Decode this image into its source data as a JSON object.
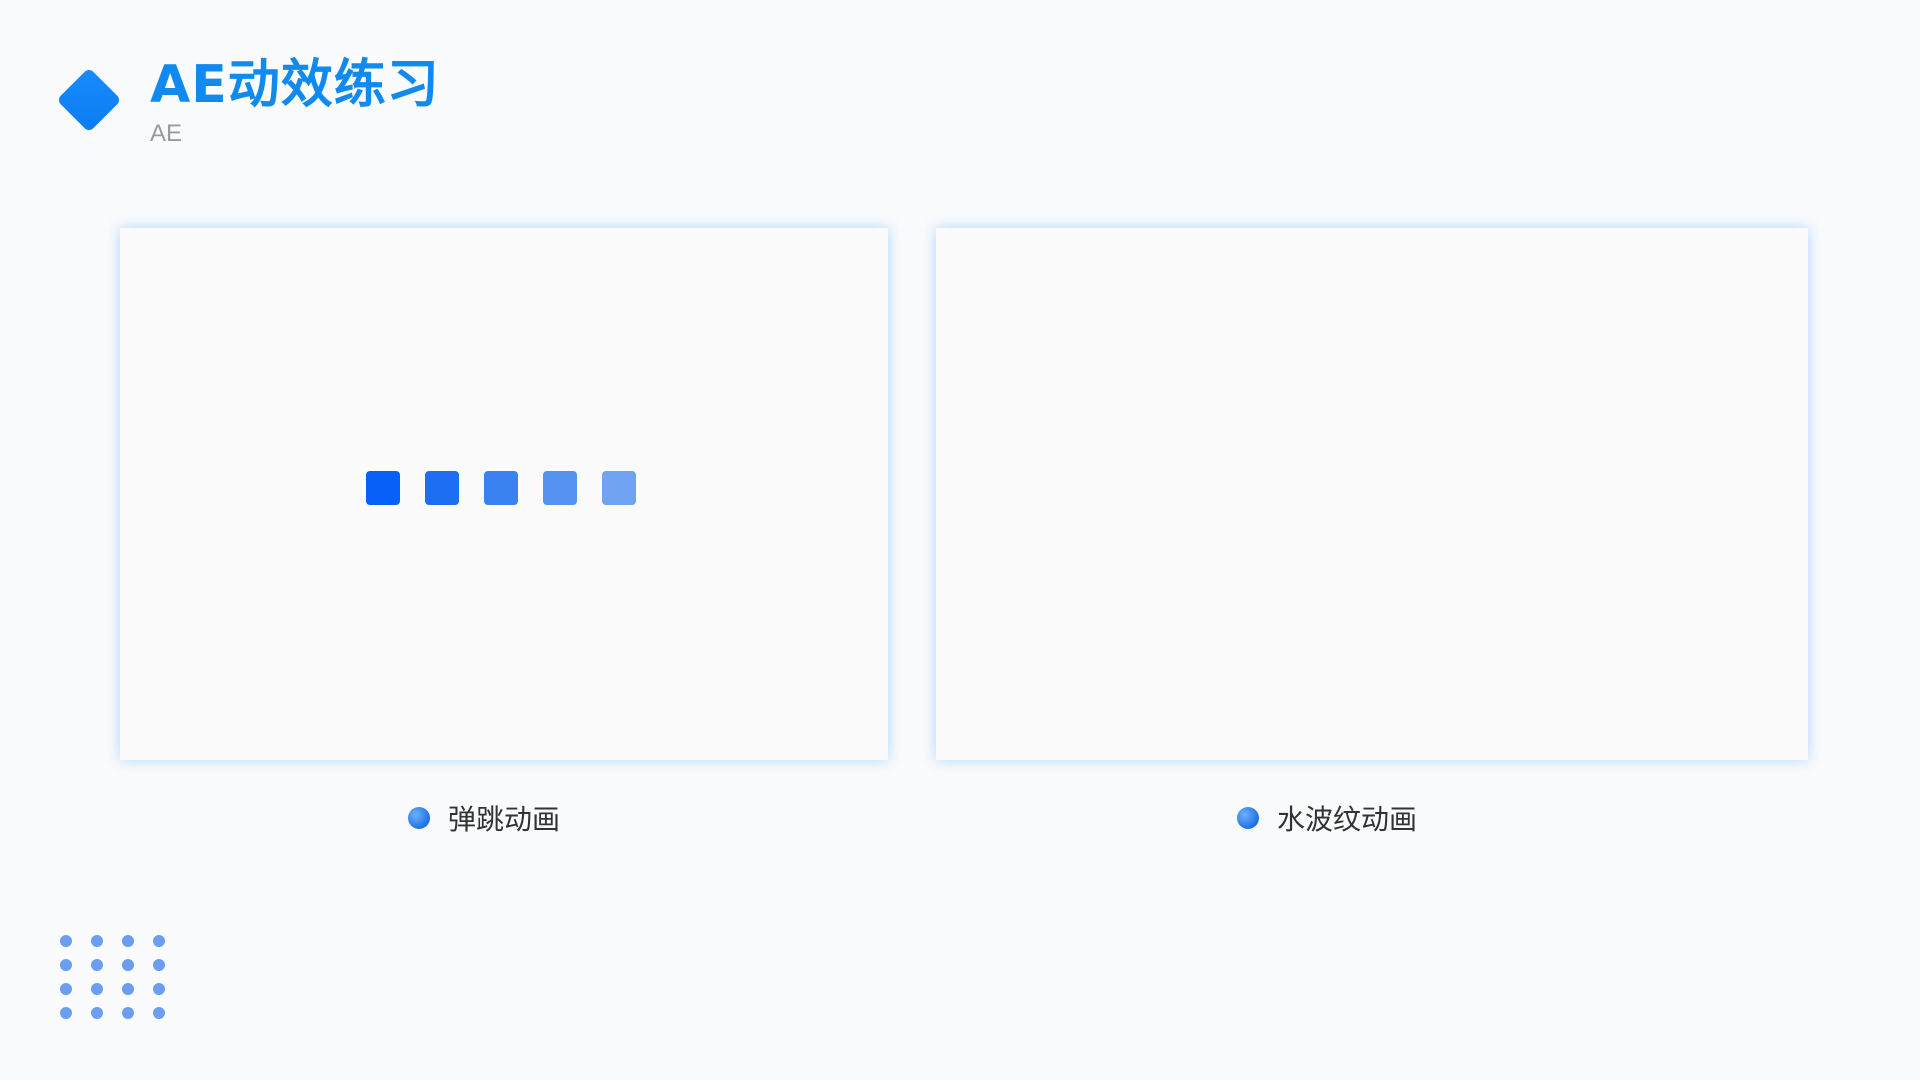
{
  "header": {
    "title": "AE动效练习",
    "subtitle": "AE"
  },
  "colors": {
    "accent": "#118af0",
    "card_glow": "#56aaff",
    "dot_color": "#6b9ef0"
  },
  "left_panel": {
    "caption": "弹跳动画",
    "squares": [
      {
        "color": "#0760f7"
      },
      {
        "color": "#1d6ef2"
      },
      {
        "color": "#3a81f1"
      },
      {
        "color": "#5592f2"
      },
      {
        "color": "#70a4f3"
      }
    ]
  },
  "right_panel": {
    "caption": "水波纹动画"
  },
  "decor": {
    "dot_rows": 4,
    "dot_cols": 4
  }
}
